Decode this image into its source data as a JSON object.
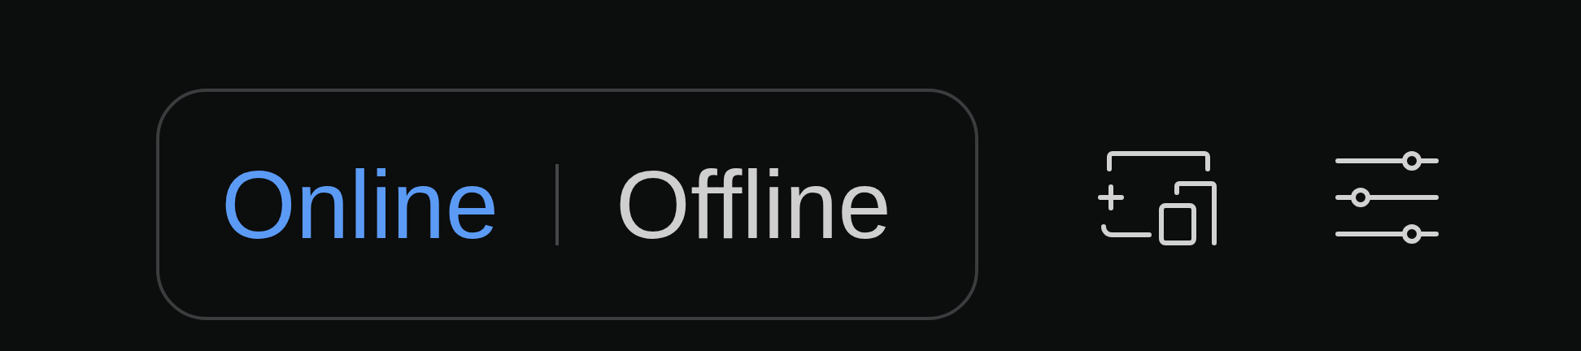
{
  "mode_toggle": {
    "options": [
      {
        "label": "Online",
        "selected": true
      },
      {
        "label": "Offline",
        "selected": false
      }
    ]
  },
  "toolbar": {
    "buttons": [
      {
        "kind": "devices"
      },
      {
        "kind": "sliders"
      }
    ]
  }
}
